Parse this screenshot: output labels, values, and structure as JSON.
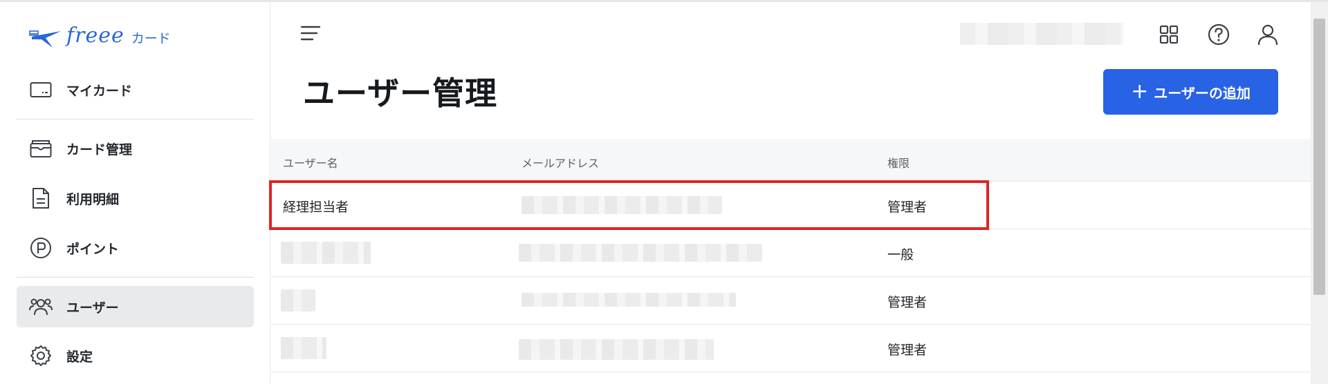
{
  "brand": {
    "logo_text": "freee",
    "logo_kana": "カード"
  },
  "sidebar": {
    "items": [
      {
        "label": "マイカード",
        "icon": "card-icon"
      },
      {
        "label": "カード管理",
        "icon": "card-manage-icon"
      },
      {
        "label": "利用明細",
        "icon": "document-icon"
      },
      {
        "label": "ポイント",
        "icon": "point-icon"
      },
      {
        "label": "ユーザー",
        "icon": "users-icon",
        "active": true
      },
      {
        "label": "設定",
        "icon": "gear-icon"
      }
    ]
  },
  "header": {
    "icons": [
      "menu-icon",
      "apps-grid-icon",
      "help-icon",
      "account-icon"
    ]
  },
  "main": {
    "title": "ユーザー管理",
    "add_button_label": "ユーザーの追加",
    "add_button_icon": "+"
  },
  "table": {
    "columns": [
      "ユーザー名",
      "メールアドレス",
      "権限"
    ],
    "rows": [
      {
        "name": "経理担当者",
        "role": "管理者"
      },
      {
        "name": "",
        "role": "一般"
      },
      {
        "name": "",
        "role": "管理者"
      },
      {
        "name": "",
        "role": "管理者"
      }
    ]
  },
  "colors": {
    "accent": "#2863e6",
    "logo": "#2a66d9",
    "highlight": "#e02525",
    "active_nav": "#e9eaec"
  }
}
